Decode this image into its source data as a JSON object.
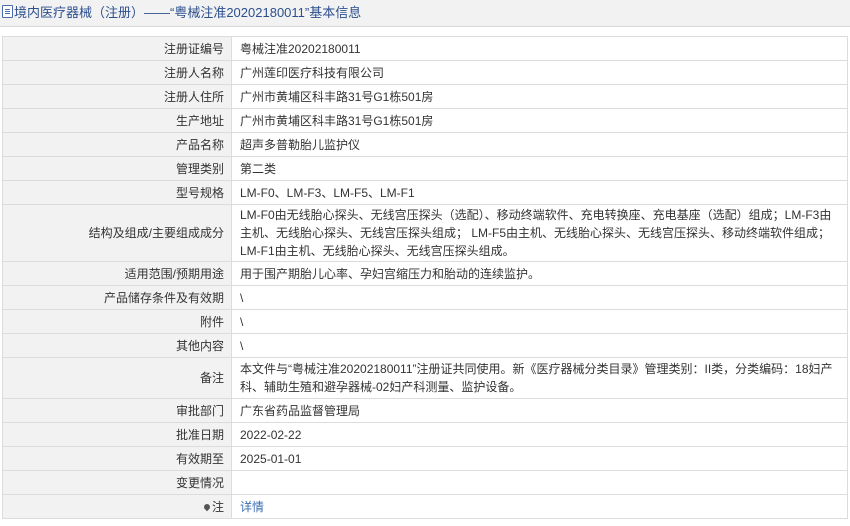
{
  "header": {
    "title": "境内医疗器械（注册）——“粤械注准20202180011”基本信息",
    "icon": "document-icon"
  },
  "rows": [
    {
      "label": "注册证编号",
      "value": "粤械注准20202180011"
    },
    {
      "label": "注册人名称",
      "value": "广州莲印医疗科技有限公司"
    },
    {
      "label": "注册人住所",
      "value": "广州市黄埔区科丰路31号G1栋501房"
    },
    {
      "label": "生产地址",
      "value": "广州市黄埔区科丰路31号G1栋501房"
    },
    {
      "label": "产品名称",
      "value": "超声多普勒胎儿监护仪"
    },
    {
      "label": "管理类别",
      "value": "第二类"
    },
    {
      "label": "型号规格",
      "value": "LM-F0、LM-F3、LM-F5、LM-F1"
    },
    {
      "label": "结构及组成/主要组成成分",
      "value": "LM-F0由无线胎心探头、无线宫压探头（选配）、移动终端软件、充电转换座、充电基座（选配）组成；LM-F3由主机、无线胎心探头、无线宫压探头组成； LM-F5由主机、无线胎心探头、无线宫压探头、移动终端软件组成；LM-F1由主机、无线胎心探头、无线宫压探头组成。"
    },
    {
      "label": "适用范围/预期用途",
      "value": "用于围产期胎儿心率、孕妇宫缩压力和胎动的连续监护。"
    },
    {
      "label": "产品储存条件及有效期",
      "value": "\\"
    },
    {
      "label": "附件",
      "value": "\\"
    },
    {
      "label": "其他内容",
      "value": "\\"
    },
    {
      "label": "备注",
      "value": "本文件与“粤械注准20202180011”注册证共同使用。新《医疗器械分类目录》管理类别：II类，分类编码：18妇产科、辅助生殖和避孕器械-02妇产科测量、监护设备。"
    },
    {
      "label": "审批部门",
      "value": "广东省药品监督管理局"
    },
    {
      "label": "批准日期",
      "value": "2022-02-22"
    },
    {
      "label": "有效期至",
      "value": "2025-01-01"
    },
    {
      "label": "变更情况",
      "value": ""
    }
  ],
  "footer_row": {
    "label": "注",
    "label_icon": "pin-icon",
    "link_text": "详情"
  },
  "colors": {
    "title_text": "#2c4f8f",
    "label_bg": "#f2f2f2",
    "border": "#dcdcdc",
    "link": "#3b6fb6"
  }
}
